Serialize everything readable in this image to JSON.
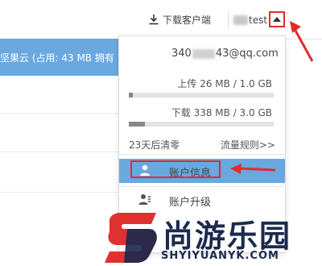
{
  "topbar": {
    "download_label": "下载客户端",
    "user_name_visible": "test"
  },
  "list": {
    "header_text": "坚果云 (占用: 43 MB   拥有"
  },
  "account_menu": {
    "email_prefix": "340",
    "email_suffix": "43@qq.com",
    "upload": {
      "label": "上传 26 MB / 1.0 GB",
      "used_fraction": 0.025
    },
    "download": {
      "label": "下载 338 MB / 3.0 GB",
      "used_fraction": 0.11
    },
    "expire_text": "23天后清零",
    "rules_link": "流量规则>>",
    "items": [
      {
        "label": "账户信息",
        "icon": "user-icon",
        "active": true
      },
      {
        "label": "账户升级",
        "icon": "user-upgrade-icon",
        "active": false
      }
    ]
  },
  "watermark": {
    "main": "尚游乐园",
    "sub": "SHYIYUANYK.COM"
  },
  "colors": {
    "accent_blue": "#6aa8e0",
    "annotation_red": "#e32b2b",
    "watermark_navy": "#1b2a4e",
    "watermark_red": "#e03030"
  }
}
